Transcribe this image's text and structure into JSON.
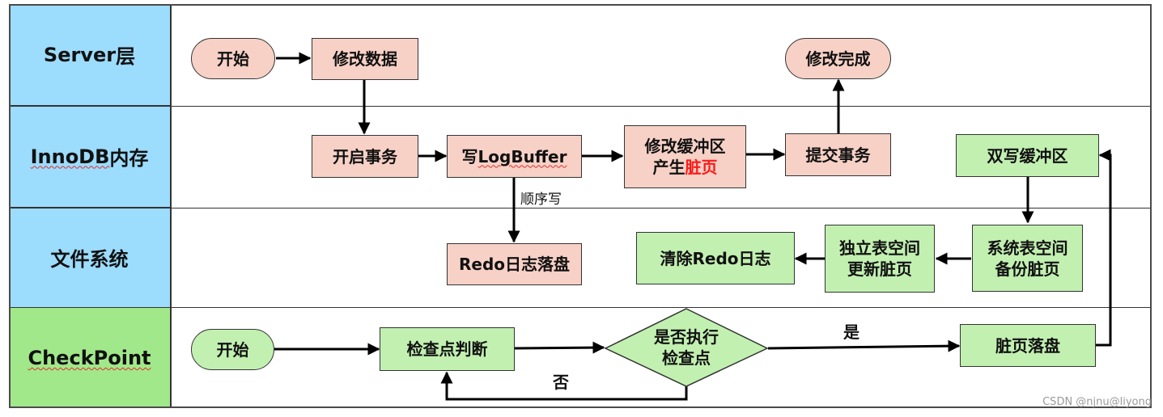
{
  "lanes": [
    {
      "label_main": "Server",
      "label_suffix": "层",
      "color": "#9cdcfd"
    },
    {
      "label_main": "InnoDB",
      "label_suffix": "内存",
      "color": "#9cdcfd"
    },
    {
      "label_main": "",
      "label_suffix": "文件系统",
      "color": "#9cdcfd"
    },
    {
      "label_main": "CheckPoint",
      "label_suffix": "",
      "color": "#a1e88a"
    }
  ],
  "nodes": {
    "server_start": "开始",
    "modify_data": "修改数据",
    "modify_done": "修改完成",
    "begin_txn": "开启事务",
    "write_logbuffer_prefix": "写",
    "write_logbuffer_main": "LogBuffer",
    "modify_buffer_line1": "修改缓冲区",
    "modify_buffer_line2_prefix": "产生",
    "modify_buffer_line2_red": "脏页",
    "commit_txn": "提交事务",
    "doublewrite_buffer": "双写缓冲区",
    "redo_flush": "Redo日志落盘",
    "clear_redo": "清除Redo日志",
    "independent_ts_line1": "独立表空间",
    "independent_ts_line2": "更新脏页",
    "system_ts_line1": "系统表空间",
    "system_ts_line2": "备份脏页",
    "cp_start": "开始",
    "checkpoint_judge": "检查点判断",
    "decision_line1": "是否执行",
    "decision_line2": "检查点",
    "dirty_flush": "脏页落盘"
  },
  "edge_labels": {
    "sequential_write": "顺序写",
    "yes": "是",
    "no": "否"
  },
  "colors": {
    "lane_blue": "#9cdcfd",
    "lane_green": "#a1e88a",
    "node_pink": "#f7d1c6",
    "node_green": "#c2f0b1",
    "highlight_red": "#ff1a1a"
  },
  "watermark": "CSDN @njnu@liyong"
}
